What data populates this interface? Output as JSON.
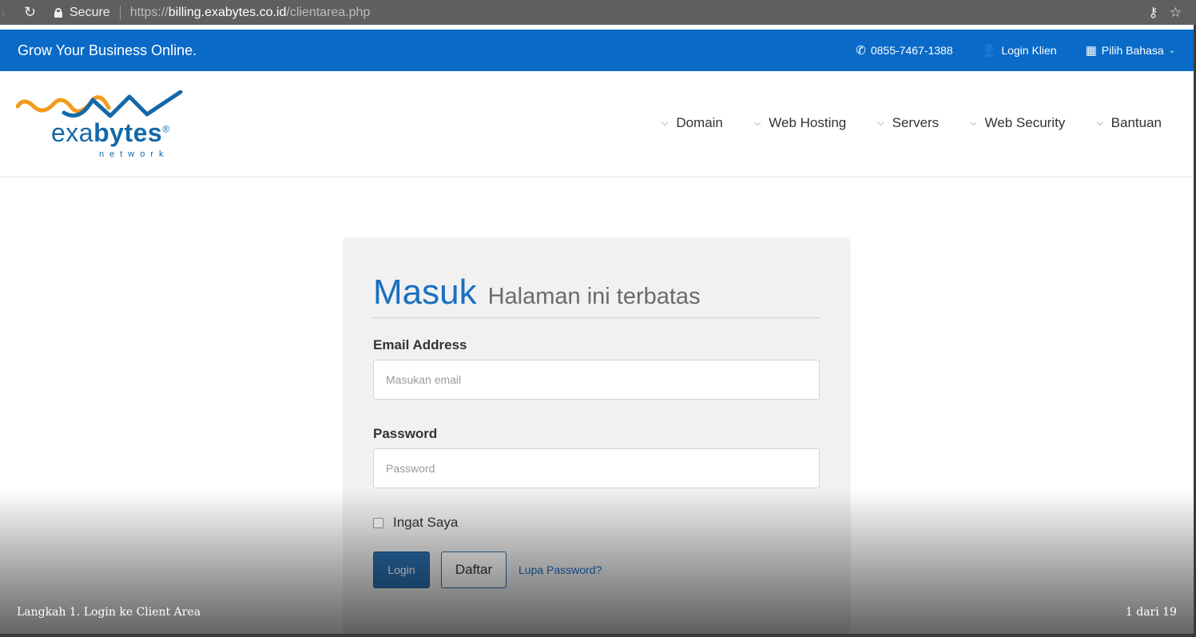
{
  "browser": {
    "secure_label": "Secure",
    "url_scheme": "https://",
    "url_host": "billing.exabytes.co.id",
    "url_path": "/clientarea.php",
    "reload_icon": "reload-icon",
    "key_icon": "key-icon",
    "star_icon": "bookmark-star-icon"
  },
  "topbar": {
    "tagline": "Grow Your Business Online.",
    "phone": "0855-7467-1388",
    "login": "Login Klien",
    "language": "Pilih Bahasa"
  },
  "logo": {
    "word_light": "exa",
    "word_bold": "bytes",
    "reg": "®",
    "subtitle": "network"
  },
  "nav": {
    "items": [
      "Domain",
      "Web Hosting",
      "Servers",
      "Web Security",
      "Bantuan"
    ]
  },
  "login_card": {
    "title": "Masuk",
    "subtitle": "Halaman ini terbatas",
    "email_label": "Email Address",
    "email_placeholder": "Masukan email",
    "password_label": "Password",
    "password_placeholder": "Password",
    "remember_label": "Ingat Saya",
    "login_button": "Login",
    "register_button": "Daftar",
    "forgot_link": "Lupa Password?"
  },
  "overlay": {
    "caption": "Langkah 1. Login ke Client Area",
    "counter": "1 dari 19"
  },
  "colors": {
    "brand_blue": "#0a6ac8",
    "title_blue": "#1a6fc0",
    "button_blue": "#2a6fae"
  }
}
